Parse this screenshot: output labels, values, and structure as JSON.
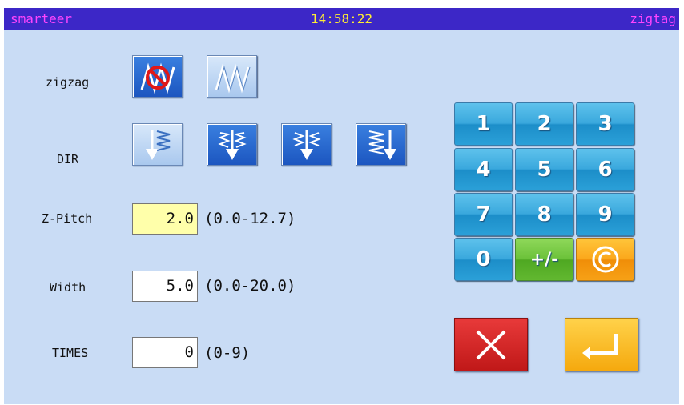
{
  "titlebar": {
    "app_name": "smarteer",
    "clock": "14:58:22",
    "mode": "zigtag"
  },
  "labels": {
    "zigzag": "zigzag",
    "dir": "DIR",
    "pitch": "Z-Pitch",
    "width": "Width",
    "times": "TIMES"
  },
  "fields": {
    "pitch": {
      "value": "2.0",
      "range": "(0.0-12.7)"
    },
    "width": {
      "value": "5.0",
      "range": "(0.0-20.0)"
    },
    "times": {
      "value": "0",
      "range": "(0-9)"
    }
  },
  "keypad": {
    "k1": "1",
    "k2": "2",
    "k3": "3",
    "k4": "4",
    "k5": "5",
    "k6": "6",
    "k7": "7",
    "k8": "8",
    "k9": "9",
    "k0": "0",
    "sign": "+/-"
  },
  "icons": {
    "zigzag_off": "zigzag-disabled-icon",
    "zigzag_on": "zigzag-icon",
    "dir_down_zigzag": "zigzag-down-arrow-icon",
    "dir_center": "center-down-arrow-icon",
    "dir_center_alt": "center-down-arrow-alt-icon",
    "dir_right": "zigzag-right-down-icon",
    "clear": "clear-icon",
    "cancel": "close-icon",
    "enter": "enter-icon"
  },
  "colors": {
    "background": "#c9dcf5",
    "titlebar": "#3c27c7",
    "clock": "#ffee33",
    "title_text": "#ff44ff",
    "active_field": "#ffffaa"
  }
}
